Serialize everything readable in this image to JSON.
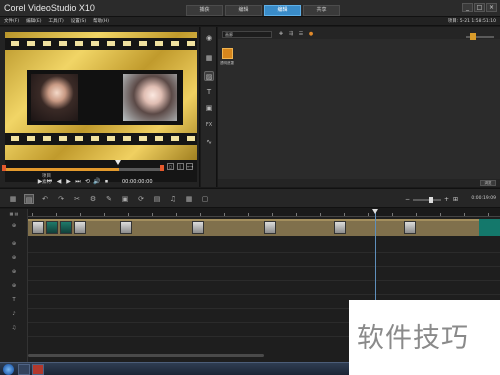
{
  "app": {
    "title": "Corel VideoStudio X10",
    "steps": [
      {
        "label": "捕获",
        "active": false
      },
      {
        "label": "编辑",
        "active": false
      },
      {
        "label": "编辑",
        "active": true
      },
      {
        "label": "共享",
        "active": false
      }
    ],
    "window_controls": [
      "_",
      "□",
      "×"
    ]
  },
  "menu": {
    "items": [
      "文件(F)",
      "编辑(E)",
      "工具(T)",
      "设置(S)",
      "帮助(H)"
    ],
    "project_time": "项目: 5-21 1:58:51:10"
  },
  "preview": {
    "mode_labels": [
      "项目",
      "素材"
    ],
    "timecode": "00:00:00:00",
    "scrub_progress": 0.72,
    "side_tools": [
      "◻",
      "|",
      "⟷"
    ]
  },
  "playback_controls": [
    "▶",
    "⏮",
    "◀",
    "▶",
    "⏭",
    "⟲",
    "🔊",
    "⏹"
  ],
  "side_toolbar_icons": [
    {
      "name": "media-icon",
      "glyph": "◉"
    },
    {
      "name": "instant-project-icon",
      "glyph": "▦"
    },
    {
      "name": "transition-icon",
      "glyph": "▨"
    },
    {
      "name": "title-icon",
      "glyph": "T"
    },
    {
      "name": "graphic-icon",
      "glyph": "▣"
    },
    {
      "name": "filter-icon",
      "glyph": "FX"
    },
    {
      "name": "path-icon",
      "glyph": "∿"
    }
  ],
  "library": {
    "dropdown": "画廊",
    "item_label": "透明遮罩",
    "browse_label": "浏览",
    "zoom_level": 0.35
  },
  "timeline_tools": [
    "▦",
    "▤",
    "↶",
    "↷",
    "✂",
    "⚙",
    "✎",
    "▣",
    "⟳",
    "▤",
    "♫",
    "▦",
    "▢"
  ],
  "timeline": {
    "time": "0:00:19:09",
    "track_icons": [
      "⊕",
      "⊕",
      "⊕",
      "⊕",
      "⊕",
      "T",
      "♪",
      "♫"
    ]
  },
  "watermark": "软件技巧"
}
